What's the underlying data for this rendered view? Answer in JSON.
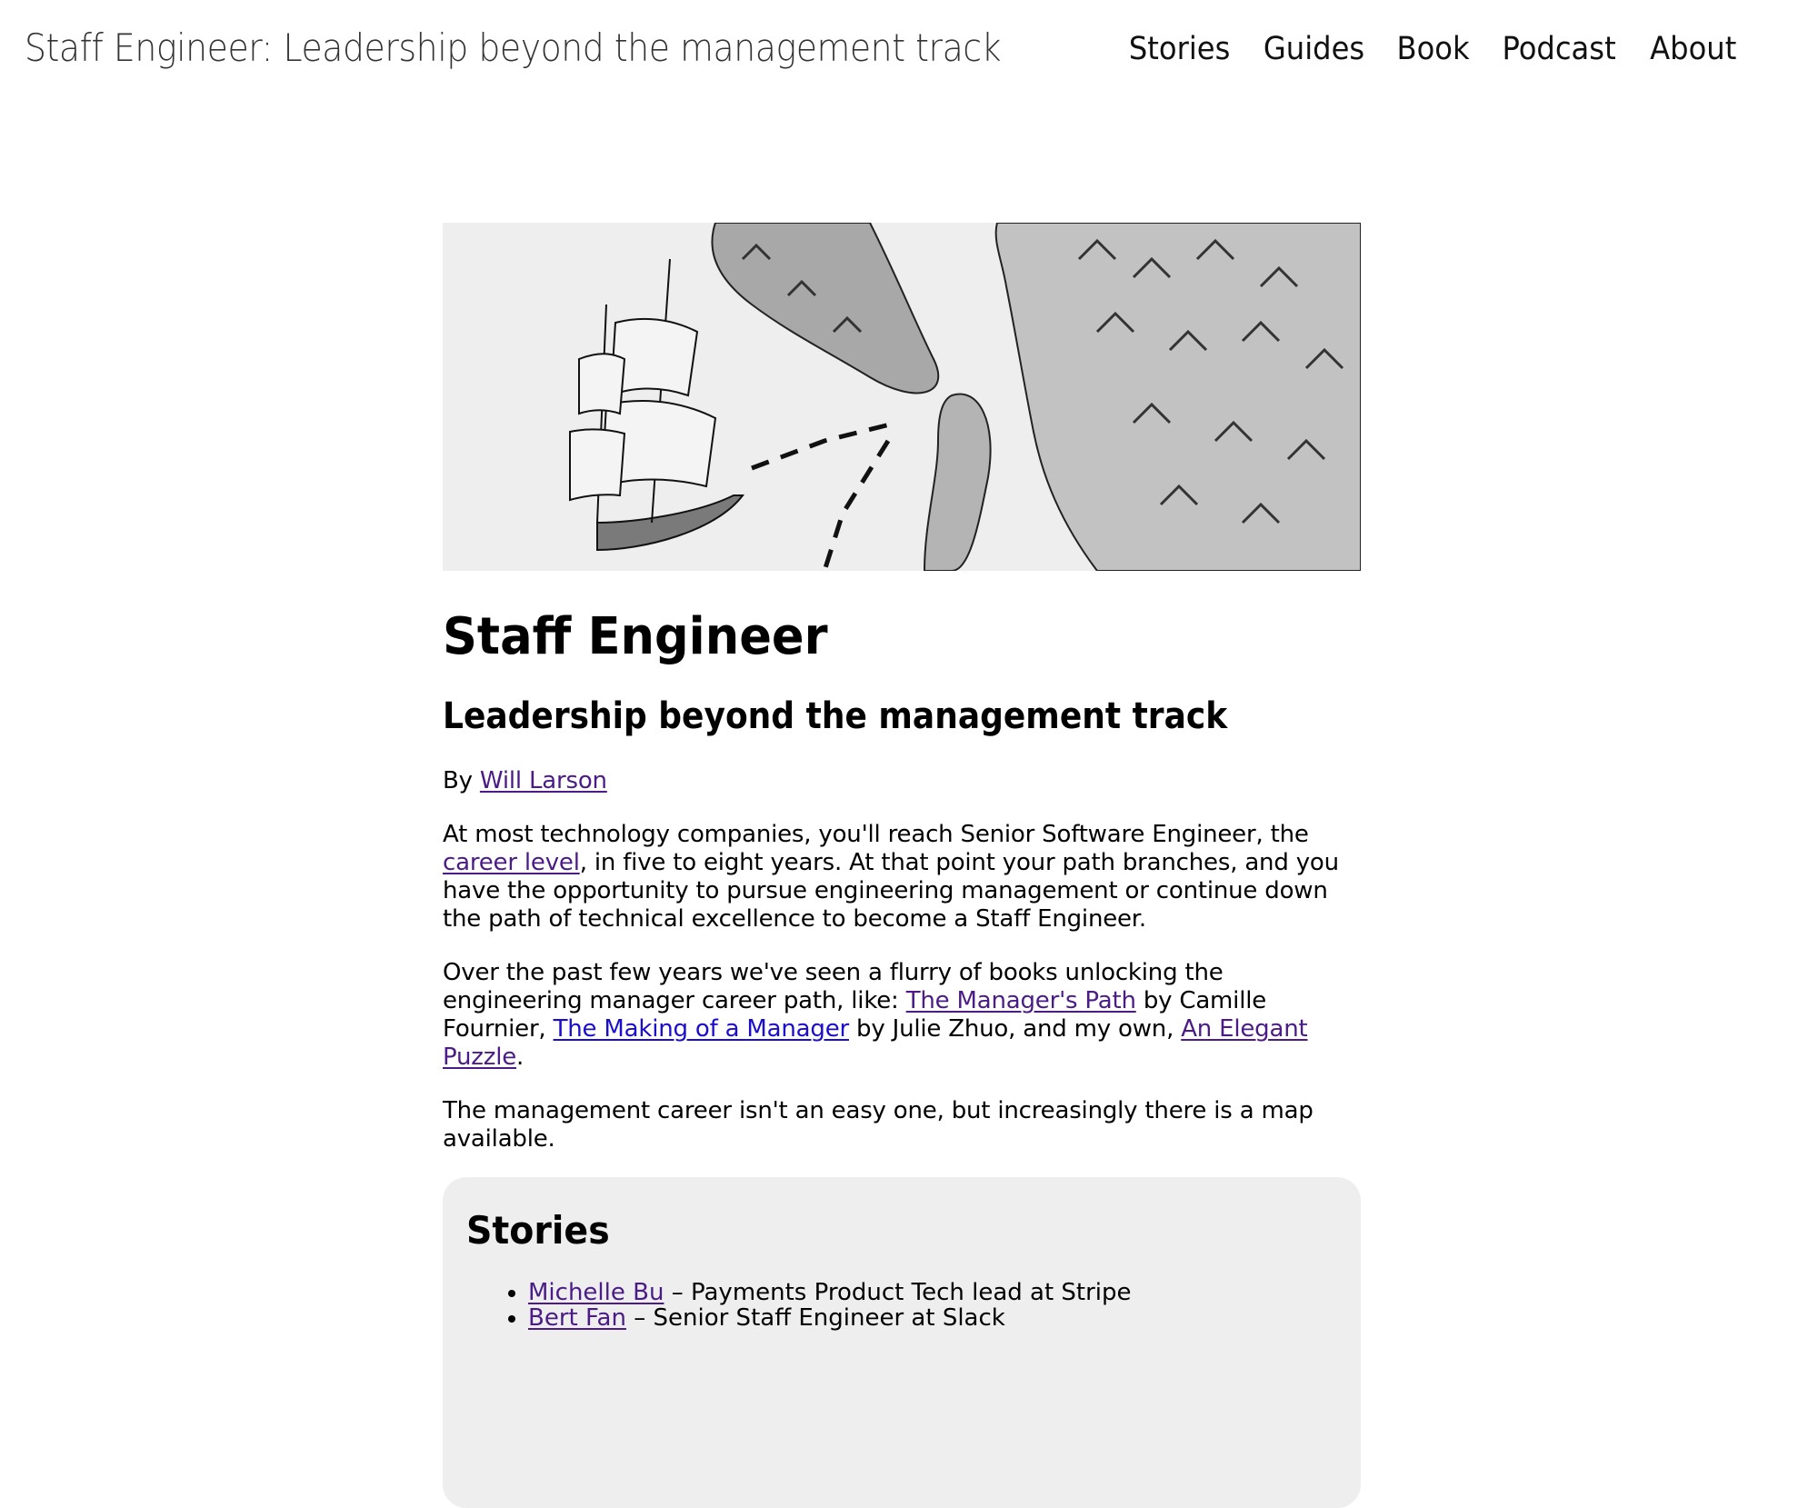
{
  "header": {
    "site_title": "Staff Engineer: Leadership beyond the management track",
    "nav": [
      "Stories",
      "Guides",
      "Book",
      "Podcast",
      "About"
    ]
  },
  "hero": {
    "image_description": "illustration"
  },
  "article": {
    "title": "Staff Engineer",
    "subtitle": "Leadership beyond the management track",
    "byline_prefix": "By ",
    "author": "Will Larson",
    "p1_a": "At most technology companies, you'll reach Senior Software Engineer, the ",
    "p1_link": "career level",
    "p1_b": ", in five to eight years. At that point your path branches, and you have the opportunity to pursue engineering management or continue down the path of technical excellence to become a Staff Engineer.",
    "p2_a": "Over the past few years we've seen a flurry of books unlocking the engineering manager career path, like: ",
    "p2_link1": "The Manager's Path",
    "p2_b": " by Camille Fournier, ",
    "p2_link2": "The Making of a Manager",
    "p2_c": " by Julie Zhuo, and my own, ",
    "p2_link3": "An Elegant Puzzle",
    "p2_d": ".",
    "p3": "The management career isn't an easy one, but increasingly there is a map available."
  },
  "stories": {
    "heading": "Stories",
    "items": [
      {
        "name": "Michelle Bu",
        "desc": " – Payments Product Tech lead at Stripe"
      },
      {
        "name": "Bert Fan",
        "desc": " – Senior Staff Engineer at Slack"
      }
    ]
  },
  "colors": {
    "link_visited": "#4b1b86",
    "link_unvisited": "#1a0dcc",
    "card_bg": "#eeeeee"
  }
}
